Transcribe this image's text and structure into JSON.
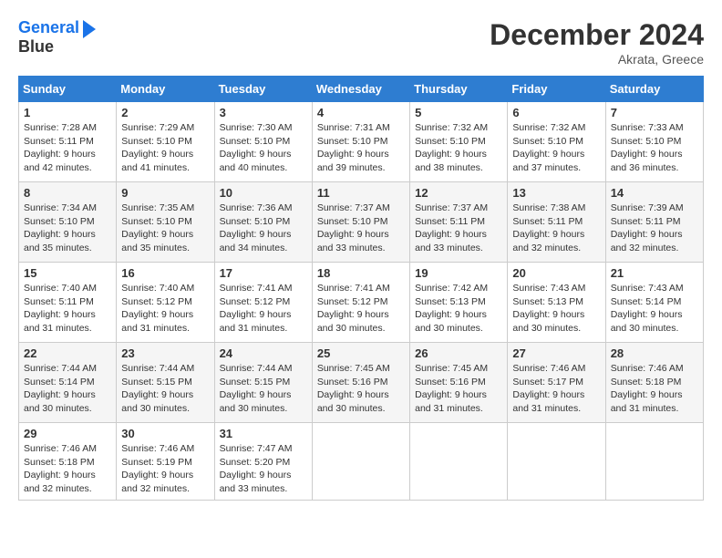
{
  "header": {
    "logo_line1": "General",
    "logo_line2": "Blue",
    "month_title": "December 2024",
    "location": "Akrata, Greece"
  },
  "days_of_week": [
    "Sunday",
    "Monday",
    "Tuesday",
    "Wednesday",
    "Thursday",
    "Friday",
    "Saturday"
  ],
  "weeks": [
    [
      {
        "day": "1",
        "sunrise": "7:28 AM",
        "sunset": "5:11 PM",
        "daylight": "9 hours and 42 minutes."
      },
      {
        "day": "2",
        "sunrise": "7:29 AM",
        "sunset": "5:10 PM",
        "daylight": "9 hours and 41 minutes."
      },
      {
        "day": "3",
        "sunrise": "7:30 AM",
        "sunset": "5:10 PM",
        "daylight": "9 hours and 40 minutes."
      },
      {
        "day": "4",
        "sunrise": "7:31 AM",
        "sunset": "5:10 PM",
        "daylight": "9 hours and 39 minutes."
      },
      {
        "day": "5",
        "sunrise": "7:32 AM",
        "sunset": "5:10 PM",
        "daylight": "9 hours and 38 minutes."
      },
      {
        "day": "6",
        "sunrise": "7:32 AM",
        "sunset": "5:10 PM",
        "daylight": "9 hours and 37 minutes."
      },
      {
        "day": "7",
        "sunrise": "7:33 AM",
        "sunset": "5:10 PM",
        "daylight": "9 hours and 36 minutes."
      }
    ],
    [
      {
        "day": "8",
        "sunrise": "7:34 AM",
        "sunset": "5:10 PM",
        "daylight": "9 hours and 35 minutes."
      },
      {
        "day": "9",
        "sunrise": "7:35 AM",
        "sunset": "5:10 PM",
        "daylight": "9 hours and 35 minutes."
      },
      {
        "day": "10",
        "sunrise": "7:36 AM",
        "sunset": "5:10 PM",
        "daylight": "9 hours and 34 minutes."
      },
      {
        "day": "11",
        "sunrise": "7:37 AM",
        "sunset": "5:10 PM",
        "daylight": "9 hours and 33 minutes."
      },
      {
        "day": "12",
        "sunrise": "7:37 AM",
        "sunset": "5:11 PM",
        "daylight": "9 hours and 33 minutes."
      },
      {
        "day": "13",
        "sunrise": "7:38 AM",
        "sunset": "5:11 PM",
        "daylight": "9 hours and 32 minutes."
      },
      {
        "day": "14",
        "sunrise": "7:39 AM",
        "sunset": "5:11 PM",
        "daylight": "9 hours and 32 minutes."
      }
    ],
    [
      {
        "day": "15",
        "sunrise": "7:40 AM",
        "sunset": "5:11 PM",
        "daylight": "9 hours and 31 minutes."
      },
      {
        "day": "16",
        "sunrise": "7:40 AM",
        "sunset": "5:12 PM",
        "daylight": "9 hours and 31 minutes."
      },
      {
        "day": "17",
        "sunrise": "7:41 AM",
        "sunset": "5:12 PM",
        "daylight": "9 hours and 31 minutes."
      },
      {
        "day": "18",
        "sunrise": "7:41 AM",
        "sunset": "5:12 PM",
        "daylight": "9 hours and 30 minutes."
      },
      {
        "day": "19",
        "sunrise": "7:42 AM",
        "sunset": "5:13 PM",
        "daylight": "9 hours and 30 minutes."
      },
      {
        "day": "20",
        "sunrise": "7:43 AM",
        "sunset": "5:13 PM",
        "daylight": "9 hours and 30 minutes."
      },
      {
        "day": "21",
        "sunrise": "7:43 AM",
        "sunset": "5:14 PM",
        "daylight": "9 hours and 30 minutes."
      }
    ],
    [
      {
        "day": "22",
        "sunrise": "7:44 AM",
        "sunset": "5:14 PM",
        "daylight": "9 hours and 30 minutes."
      },
      {
        "day": "23",
        "sunrise": "7:44 AM",
        "sunset": "5:15 PM",
        "daylight": "9 hours and 30 minutes."
      },
      {
        "day": "24",
        "sunrise": "7:44 AM",
        "sunset": "5:15 PM",
        "daylight": "9 hours and 30 minutes."
      },
      {
        "day": "25",
        "sunrise": "7:45 AM",
        "sunset": "5:16 PM",
        "daylight": "9 hours and 30 minutes."
      },
      {
        "day": "26",
        "sunrise": "7:45 AM",
        "sunset": "5:16 PM",
        "daylight": "9 hours and 31 minutes."
      },
      {
        "day": "27",
        "sunrise": "7:46 AM",
        "sunset": "5:17 PM",
        "daylight": "9 hours and 31 minutes."
      },
      {
        "day": "28",
        "sunrise": "7:46 AM",
        "sunset": "5:18 PM",
        "daylight": "9 hours and 31 minutes."
      }
    ],
    [
      {
        "day": "29",
        "sunrise": "7:46 AM",
        "sunset": "5:18 PM",
        "daylight": "9 hours and 32 minutes."
      },
      {
        "day": "30",
        "sunrise": "7:46 AM",
        "sunset": "5:19 PM",
        "daylight": "9 hours and 32 minutes."
      },
      {
        "day": "31",
        "sunrise": "7:47 AM",
        "sunset": "5:20 PM",
        "daylight": "9 hours and 33 minutes."
      },
      null,
      null,
      null,
      null
    ]
  ]
}
